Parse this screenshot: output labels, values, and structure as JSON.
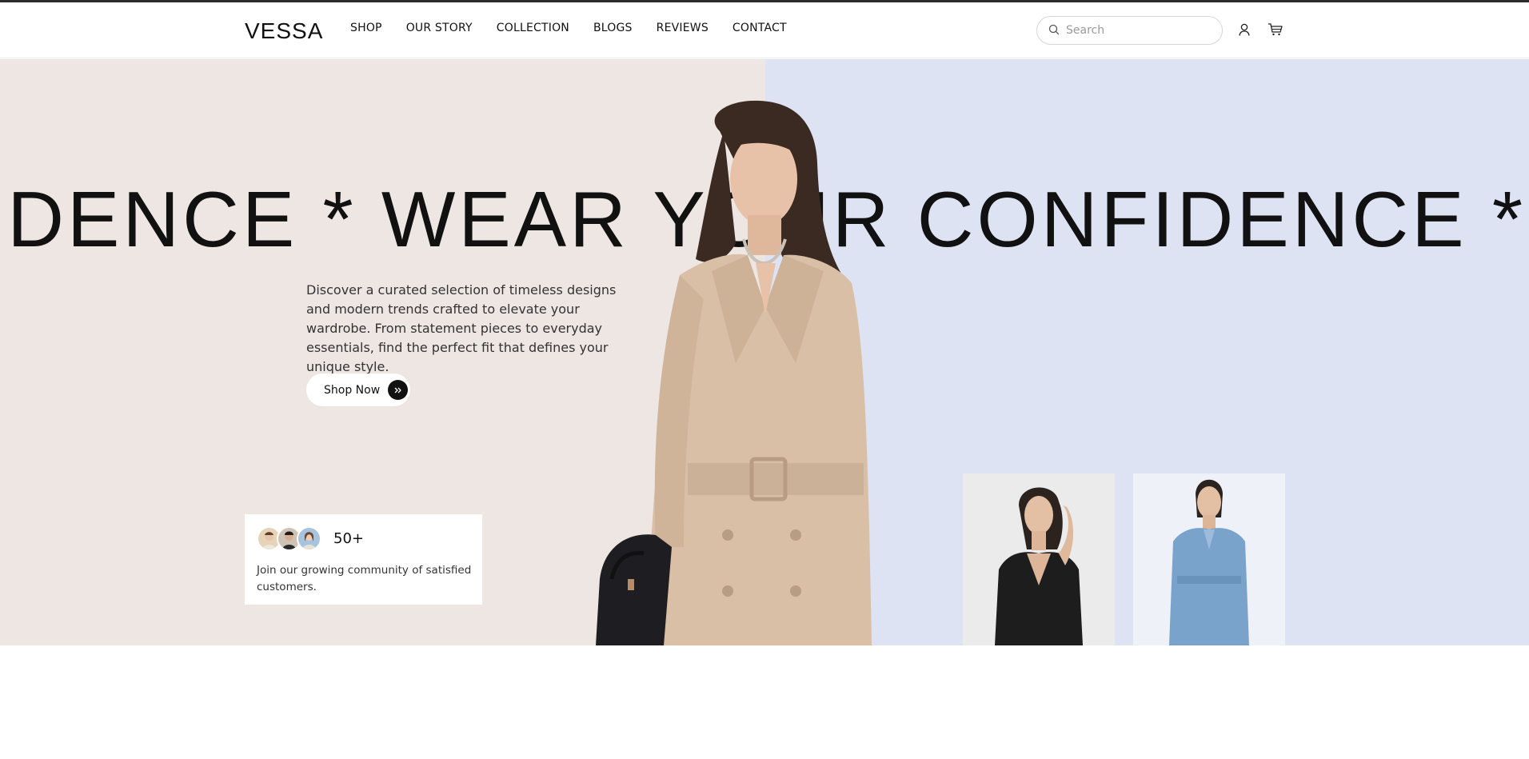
{
  "header": {
    "logo": "VESSA",
    "nav": [
      "SHOP",
      "OUR STORY",
      "COLLECTION",
      "BLOGS",
      "REVIEWS",
      "CONTACT"
    ],
    "search_placeholder": "Search",
    "icons": [
      "search-icon",
      "user-icon",
      "cart-icon"
    ]
  },
  "hero": {
    "marquee": "IDENCE * WEAR YOUR CONFIDENCE * WEAR Y",
    "description": "Discover a curated selection of timeless designs and modern trends crafted to elevate your wardrobe. From statement pieces to everyday essentials, find the perfect fit that defines your unique style.",
    "cta_label": "Shop Now",
    "community": {
      "count": "50+",
      "text": "Join our growing community of satisfied customers."
    }
  },
  "colors": {
    "left_bg": "#eee6e3",
    "right_bg": "#dde3f3",
    "text": "#111111"
  }
}
